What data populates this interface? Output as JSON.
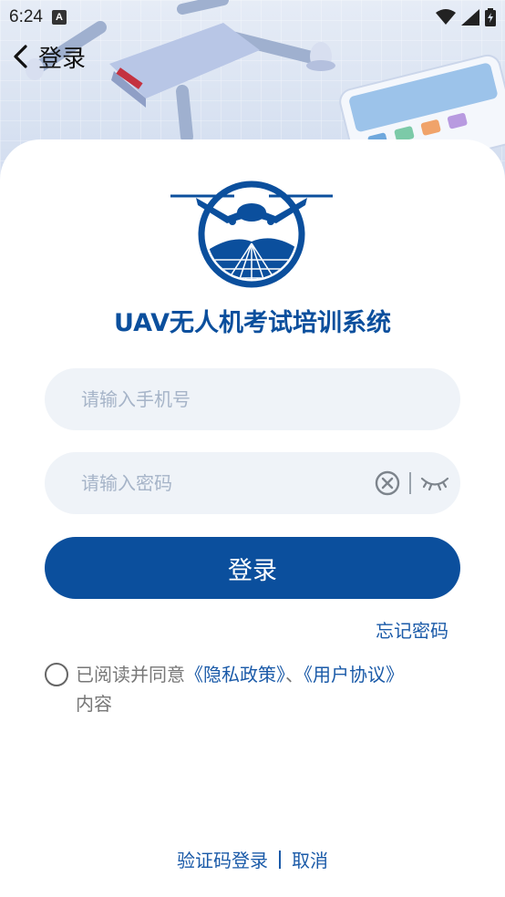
{
  "status_bar": {
    "time": "6:24",
    "notification_glyph": "A"
  },
  "nav": {
    "title": "登录"
  },
  "app": {
    "title": "UAV无人机考试培训系统"
  },
  "form": {
    "phone_placeholder": "请输入手机号",
    "password_placeholder": "请输入密码",
    "login_button": "登录",
    "forgot_password": "忘记密码"
  },
  "agreement": {
    "prefix": "已阅读并同意",
    "privacy_policy": "《隐私政策》",
    "joiner": "、",
    "user_agreement": "《用户协议》",
    "suffix": "内容"
  },
  "bottom": {
    "code_login": "验证码登录",
    "separator": "|",
    "cancel": "取消"
  },
  "colors": {
    "primary": "#0b4f9d",
    "link": "#1a5aa8",
    "field_bg": "#eff3f8",
    "placeholder": "#a6b4c8"
  }
}
